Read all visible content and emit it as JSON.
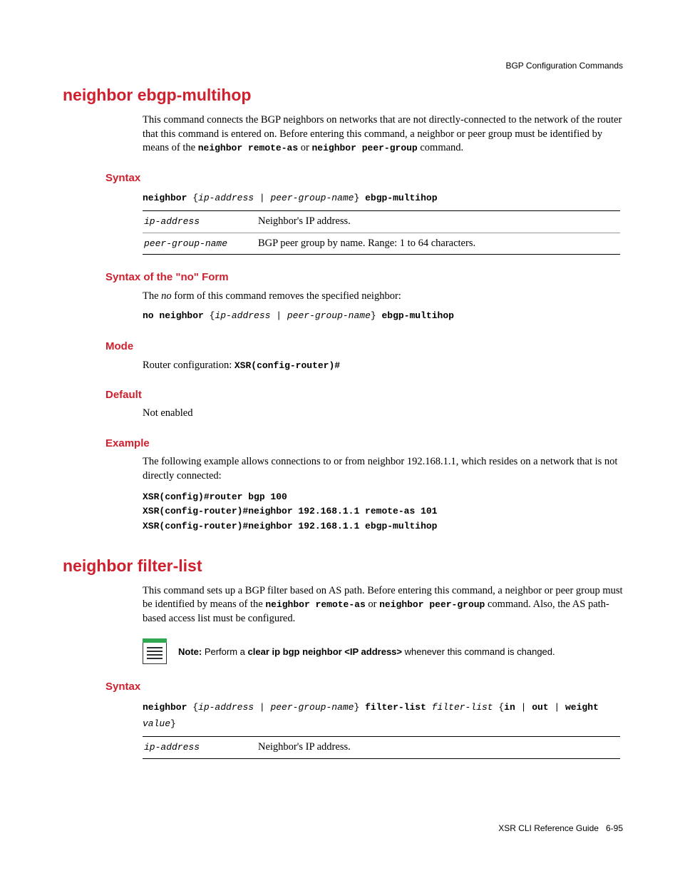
{
  "header": {
    "running": "BGP Configuration Commands"
  },
  "footer": {
    "book": "XSR CLI Reference Guide",
    "page": "6-95"
  },
  "cmd1": {
    "title": "neighbor ebgp-multihop",
    "desc_pre": "This command connects the BGP neighbors on networks that are not directly-connected to the network of the router that this command is entered on. Before entering this command, a neighbor or peer group must be identified by means of the ",
    "desc_code1": "neighbor remote-as",
    "desc_mid": " or ",
    "desc_code2": "neighbor peer-group",
    "desc_post": " command.",
    "syntax_label": "Syntax",
    "syn": {
      "kw1": "neighbor",
      "brace_o": " {",
      "arg1": "ip-address",
      "pipe": " | ",
      "arg2": "peer-group-name",
      "brace_c": "} ",
      "kw2": "ebgp-multihop"
    },
    "params": [
      {
        "name": "ip-address",
        "desc": "Neighbor's IP address."
      },
      {
        "name": "peer-group-name",
        "desc": "BGP peer group by name. Range: 1 to 64 characters."
      }
    ],
    "noform_label": "Syntax of the \"no\" Form",
    "noform_text_pre": "The ",
    "noform_text_i": "no",
    "noform_text_post": " form of this command removes the specified neighbor:",
    "nosyn_kw1": "no neighbor",
    "mode_label": "Mode",
    "mode_text": "Router configuration: ",
    "mode_code": "XSR(config-router)#",
    "default_label": "Default",
    "default_text": "Not enabled",
    "example_label": "Example",
    "example_text": "The following example allows connections to or from neighbor 192.168.1.1, which resides on a network that is not directly connected:",
    "example_code1": "XSR(config)#router bgp 100",
    "example_code2": "XSR(config-router)#neighbor 192.168.1.1 remote-as 101",
    "example_code3": "XSR(config-router)#neighbor 192.168.1.1 ebgp-multihop"
  },
  "cmd2": {
    "title": "neighbor filter-list",
    "desc_pre": "This command sets up a BGP filter based on AS path. Before entering this command, a neighbor or peer group must be identified by means of the ",
    "desc_code1": "neighbor remote-as",
    "desc_mid": " or ",
    "desc_code2": "neighbor peer-group",
    "desc_post": " command. Also, the AS path-based access list must be configured.",
    "note_label": "Note:",
    "note_pre": " Perform a ",
    "note_bold": "clear ip bgp neighbor <IP address>",
    "note_post": " whenever this command is changed.",
    "syntax_label": "Syntax",
    "syn": {
      "kw1": "neighbor",
      "brace_o": " {",
      "arg1": "ip-address",
      "pipe1": " | ",
      "arg2": "peer-group-name",
      "brace_c": "} ",
      "kw2": "filter-list",
      "sp": " ",
      "arg3": "filter-list",
      "brace2_o": " {",
      "kw_in": "in",
      "pipe2": " | ",
      "kw_out": "out",
      "pipe3": " | ",
      "kw_weight": "weight",
      "sp2": " ",
      "arg4": "value",
      "brace2_c": "}"
    },
    "params": [
      {
        "name": "ip-address",
        "desc": "Neighbor's IP address."
      }
    ]
  }
}
